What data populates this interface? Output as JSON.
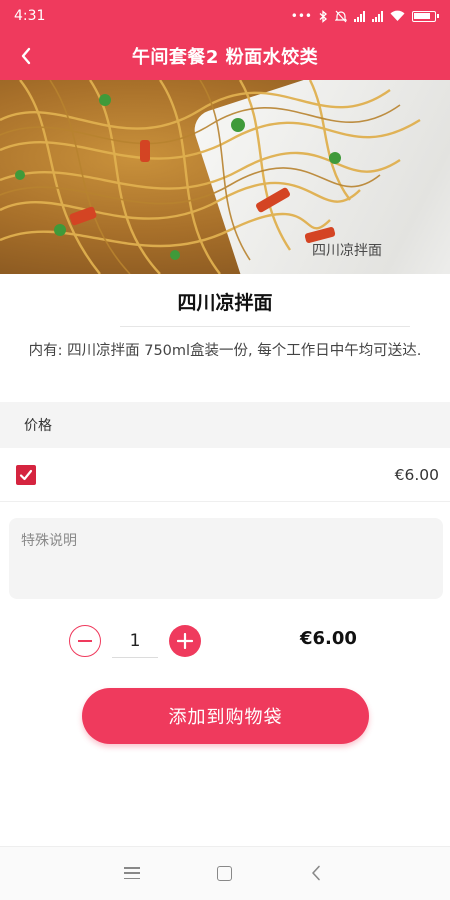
{
  "status_bar": {
    "time": "4:31",
    "icons": [
      "dots-icon",
      "bluetooth-icon",
      "mute-icon",
      "signal-icon",
      "wifi-icon",
      "battery-icon"
    ]
  },
  "app_bar": {
    "title": "午间套餐2 粉面水饺类",
    "back_icon": "chevron-left-icon"
  },
  "hero": {
    "caption": "四川凉拌面"
  },
  "dish": {
    "name": "四川凉拌面",
    "description": "内有: 四川凉拌面 750ml盒装一份, 每个工作日中午均可送达."
  },
  "price_section": {
    "header": "价格",
    "option": {
      "checked": true,
      "price": "€6.00"
    }
  },
  "notes": {
    "placeholder": "特殊说明",
    "value": ""
  },
  "quantity": {
    "value": "1",
    "total": "€6.00"
  },
  "add_button": {
    "label": "添加到购物袋"
  },
  "colors": {
    "accent": "#ef3a5d",
    "checkbox": "#d5243f"
  }
}
